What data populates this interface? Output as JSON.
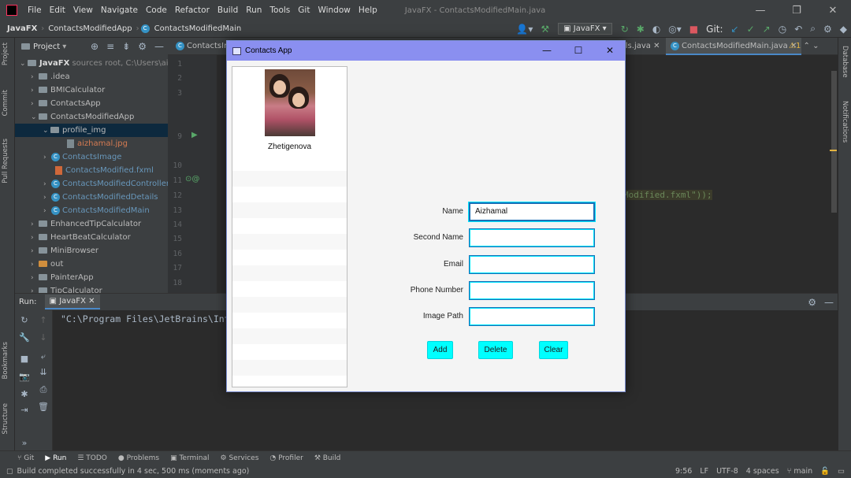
{
  "ide": {
    "title": "JavaFX - ContactsModifiedMain.java",
    "menu": [
      "File",
      "Edit",
      "View",
      "Navigate",
      "Code",
      "Refactor",
      "Build",
      "Run",
      "Tools",
      "Git",
      "Window",
      "Help"
    ],
    "breadcrumbs": [
      "JavaFX",
      "ContactsModifiedApp",
      "ContactsModifiedMain"
    ],
    "run_config": "JavaFX",
    "git_label": "Git:"
  },
  "project": {
    "header": "Project",
    "tree": [
      {
        "label": "JavaFX",
        "extra": "sources root, C:\\Users\\ai",
        "type": "folder",
        "indent": 0,
        "expanded": true
      },
      {
        "label": ".idea",
        "type": "folder",
        "indent": 1
      },
      {
        "label": "BMICalculator",
        "type": "folder",
        "indent": 1
      },
      {
        "label": "ContactsApp",
        "type": "folder",
        "indent": 1
      },
      {
        "label": "ContactsModifiedApp",
        "type": "folder",
        "indent": 1,
        "expanded": true
      },
      {
        "label": "profile_img",
        "type": "folder",
        "indent": 2,
        "expanded": true,
        "selected": true
      },
      {
        "label": "aizhamal.jpg",
        "type": "file",
        "indent": 3,
        "color": "orange"
      },
      {
        "label": "ContactsImage",
        "type": "class",
        "indent": 2,
        "color": "blue"
      },
      {
        "label": "ContactsModified.fxml",
        "type": "xml",
        "indent": 2,
        "color": "blue"
      },
      {
        "label": "ContactsModifiedController",
        "type": "class",
        "indent": 2,
        "color": "blue"
      },
      {
        "label": "ContactsModifiedDetails",
        "type": "class",
        "indent": 2,
        "color": "blue"
      },
      {
        "label": "ContactsModifiedMain",
        "type": "class",
        "indent": 2,
        "color": "blue"
      },
      {
        "label": "EnhancedTipCalculator",
        "type": "folder",
        "indent": 1
      },
      {
        "label": "HeartBeatCalculator",
        "type": "folder",
        "indent": 1
      },
      {
        "label": "MiniBrowser",
        "type": "folder",
        "indent": 1
      },
      {
        "label": "out",
        "type": "folder",
        "indent": 1,
        "orange": true
      },
      {
        "label": "PainterApp",
        "type": "folder",
        "indent": 1
      },
      {
        "label": "TipCalculator",
        "type": "folder",
        "indent": 1
      }
    ]
  },
  "editor": {
    "tabs": [
      "ContactsIm",
      "ils.java",
      "ContactsModifiedMain.java"
    ],
    "line_numbers": [
      "1",
      "2",
      "3",
      "",
      "",
      "9",
      "",
      "10",
      "11",
      "12",
      "13",
      "14",
      "15",
      "16",
      "17",
      "18"
    ],
    "code_snippet": "Modified.fxml\"));",
    "warning_count": "1"
  },
  "run": {
    "label": "Run:",
    "tab": "JavaFX",
    "console": "\"C:\\Program Files\\JetBrains\\Int"
  },
  "strip": {
    "left": [
      "Project",
      "Commit",
      "Pull Requests",
      "Bookmarks",
      "Structure"
    ],
    "right": [
      "Database",
      "Notifications"
    ]
  },
  "bottom_tabs": [
    "Git",
    "Run",
    "TODO",
    "Problems",
    "Terminal",
    "Services",
    "Profiler",
    "Build"
  ],
  "status": {
    "message": "Build completed successfully in 4 sec, 500 ms (moments ago)",
    "position": "9:56",
    "line_sep": "LF",
    "encoding": "UTF-8",
    "indent": "4 spaces",
    "branch": "main"
  },
  "dialog": {
    "title": "Contacts App",
    "contact_name": "Zhetigenova",
    "fields": [
      {
        "label": "Name",
        "value": "Aizhamal"
      },
      {
        "label": "Second Name",
        "value": ""
      },
      {
        "label": "Email",
        "value": ""
      },
      {
        "label": "Phone Number",
        "value": ""
      },
      {
        "label": "Image Path",
        "value": ""
      }
    ],
    "buttons": {
      "add": "Add",
      "delete": "Delete",
      "clear": "Clear"
    },
    "window_controls": {
      "minimize": "—",
      "maximize": "☐",
      "close": "✕"
    }
  },
  "colors": {
    "dialog_title_bg": "#8a8ff0",
    "button_bg": "#00ffff",
    "field_border": "#1b6fb5",
    "ide_bg": "#2b2b2b"
  }
}
